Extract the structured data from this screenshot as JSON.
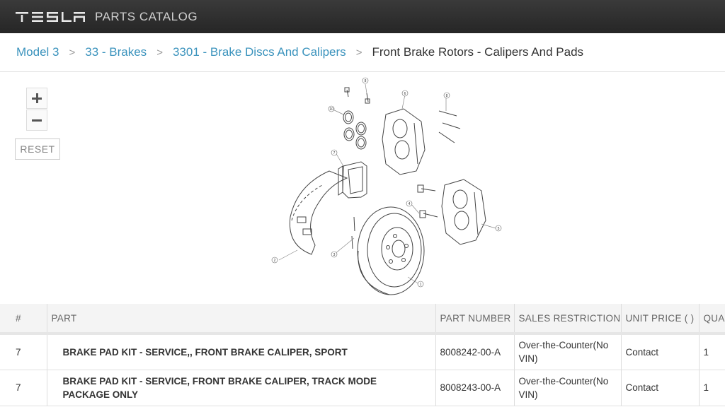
{
  "app": {
    "brand": "TESLA",
    "title": "PARTS CATALOG"
  },
  "breadcrumb": [
    {
      "label": "Model 3"
    },
    {
      "label": "33 - Brakes"
    },
    {
      "label": "3301 - Brake Discs And Calipers"
    },
    {
      "label": "Front Brake Rotors - Calipers And Pads"
    }
  ],
  "breadcrumb_separator": ">",
  "viewer": {
    "zoom_in": "+",
    "zoom_out": "−",
    "reset_label": "RESET"
  },
  "diagram_callouts": [
    "1",
    "2",
    "3",
    "4",
    "5",
    "6",
    "7",
    "8",
    "8",
    "10"
  ],
  "table": {
    "headers": [
      "#",
      "PART",
      "PART NUMBER",
      "SALES RESTRICTION",
      "UNIT PRICE ( )",
      "QUA"
    ],
    "rows": [
      {
        "num": "7",
        "part": "BRAKE PAD KIT - SERVICE,, FRONT BRAKE CALIPER, SPORT",
        "part_number": "8008242-00-A",
        "restriction": "Over-the-Counter(No VIN)",
        "price": "Contact",
        "qty": "1"
      },
      {
        "num": "7",
        "part": "BRAKE PAD KIT - SERVICE, FRONT BRAKE CALIPER, TRACK MODE PACKAGE ONLY",
        "part_number": "8008243-00-A",
        "restriction": "Over-the-Counter(No VIN)",
        "price": "Contact",
        "qty": "1"
      }
    ]
  },
  "colors": {
    "link": "#3b93bd",
    "topbar": "#2e2e2e"
  }
}
